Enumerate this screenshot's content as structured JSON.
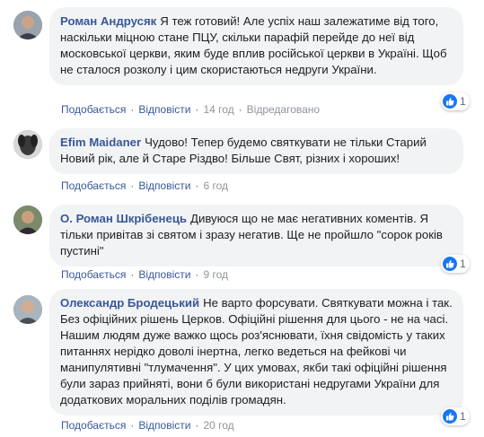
{
  "comments": [
    {
      "author": "Роман Андрусяк",
      "text": "Я теж готовий! Але успіх наш залежатиме від того, наскільки міцною стане ПЦУ, скільки парафій перейде до неї від московської церкви, яким буде вплив російської церкви в Україні. Щоб не сталося розколу і цим скористаються недруги України.",
      "like_label": "Подобається",
      "reply_label": "Відповісти",
      "time": "14 год",
      "edited": "Відредаговано",
      "reactions": "1"
    },
    {
      "author": "Efim Maidaner",
      "text": "Чудово! Тепер будемо святкувати не тільки Старий Новий рік, але й Старе Різдво! Більше Свят, різних і хороших!",
      "like_label": "Подобається",
      "reply_label": "Відповісти",
      "time": "6 год"
    },
    {
      "author": "О. Роман Шкрібенець",
      "text": "Дивуюся що не має негативних коментів. Я тільки привітав зі святом і зразу негатив. Ще не пройшло \"сорок років пустині\"",
      "like_label": "Подобається",
      "reply_label": "Відповісти",
      "time": "9 год",
      "reactions": "1"
    },
    {
      "author": "Олександр Бродецький",
      "text": "Не варто форсувати. Святкувати можна і так. Без офіційних рішень Церков. Офіційні рішення для цього - не на часі. Нашим людям дуже важко щось роз'яснювати, їхня свідомість у таких питаннях нерідко доволі інертна, легко ведеться на фейкові чи манипулятивні \"тлумачення\". У цих умовах, якби такі офіційні рішення були зараз прийняті, вони б були використані недругами України для додаткових моральних поділів громадян.",
      "like_label": "Подобається",
      "reply_label": "Відповісти",
      "time": "20 год",
      "reactions": "1"
    }
  ],
  "icons": {
    "reaction": "thumbs-up-icon",
    "avatar": "user-avatar"
  },
  "colors": {
    "author": "#385898",
    "bubble": "#f2f3f5",
    "like_blue": "#1877f2"
  }
}
